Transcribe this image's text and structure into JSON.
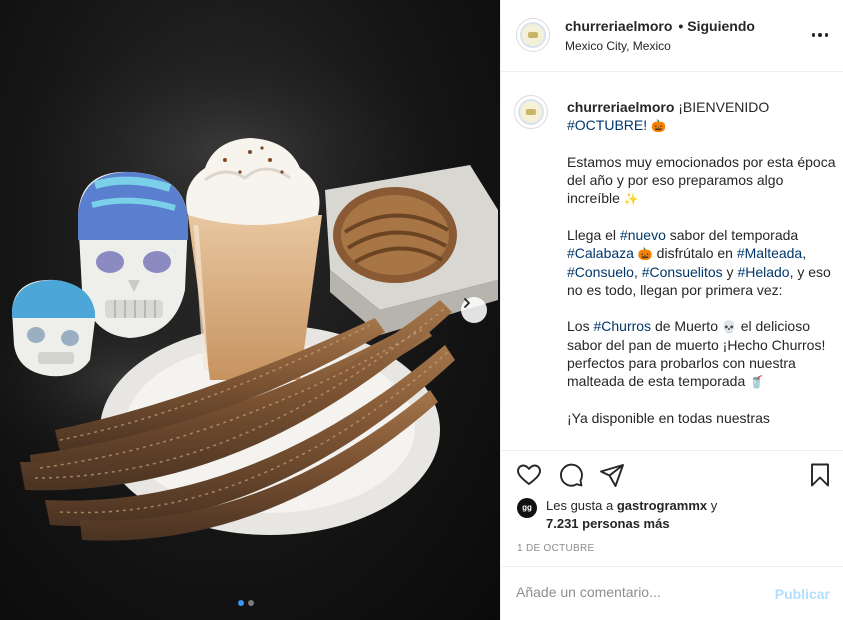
{
  "post": {
    "username": "churreriaelmoro",
    "follow_status": "Siguiendo",
    "separator": "•",
    "location": "Mexico City, Mexico",
    "more_icon": "more-options-icon"
  },
  "photo": {
    "carousel_count": 2,
    "carousel_active": 1,
    "next_icon": "chevron-right-icon"
  },
  "caption": {
    "username": "churreriaelmoro",
    "line1_pre": "¡BIENVENIDO ",
    "line1_tag": "#OCTUBRE!",
    "line1_emoji": "🎃",
    "p1": "Estamos muy emocionados por esta época del año y por eso preparamos algo increíble",
    "p1_emoji": "✨",
    "p2_pre": "Llega el ",
    "p2_tag1": "#nuevo",
    "p2_mid1": " sabor del temporada ",
    "p2_tag2": "#Calabaza",
    "p2_emoji": "🎃",
    "p2_mid2": " disfrútalo en ",
    "p2_tag3": "#Malteada",
    "p2_sep1": ", ",
    "p2_tag4": "#Consuelo",
    "p2_sep2": ", ",
    "p2_tag5": "#Consuelitos",
    "p2_mid3": " y ",
    "p2_tag6": "#Helado",
    "p2_end": ", y eso no es todo, llegan por primera vez:",
    "p3_pre": "Los ",
    "p3_tag": "#Churros",
    "p3_mid": " de Muerto ",
    "p3_emoji": "💀",
    "p3_end": " el delicioso sabor del pan de muerto ¡Hecho Churros! perfectos para probarlos con nuestra malteada de esta temporada",
    "p3_emoji2": "🥤",
    "p4": "¡Ya disponible en todas nuestras"
  },
  "actions": {
    "like_icon": "heart-icon",
    "comment_icon": "comment-icon",
    "share_icon": "share-icon",
    "save_icon": "bookmark-icon"
  },
  "likes": {
    "avatar_text": "gg",
    "prefix": "Les gusta a ",
    "user": "gastrogrammx",
    "mid": " y",
    "count": "7.231 personas más"
  },
  "date": "1 DE OCTUBRE",
  "comment_box": {
    "placeholder": "Añade un comentario...",
    "publish_label": "Publicar"
  },
  "colors": {
    "link": "#00376b",
    "publish_disabled": "#b2dffc",
    "border": "#efefef",
    "carousel_active": "#3897f0"
  }
}
